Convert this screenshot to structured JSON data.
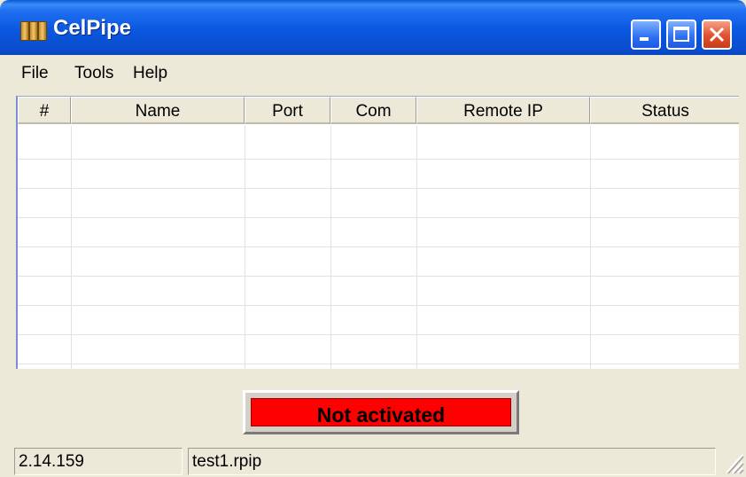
{
  "window": {
    "title": "CelPipe"
  },
  "menu": {
    "items": [
      "File",
      "Tools",
      "Help"
    ]
  },
  "table": {
    "columns": [
      "#",
      "Name",
      "Port",
      "Com",
      "Remote IP",
      "Status"
    ],
    "rows": []
  },
  "activation": {
    "label": "Not activated",
    "color": "#ff0000"
  },
  "status": {
    "version": "2.14.159",
    "file": "test1.rpip"
  },
  "icons": [
    "app-icon",
    "minimize-icon",
    "maximize-icon",
    "close-icon",
    "resize-grip-icon"
  ]
}
